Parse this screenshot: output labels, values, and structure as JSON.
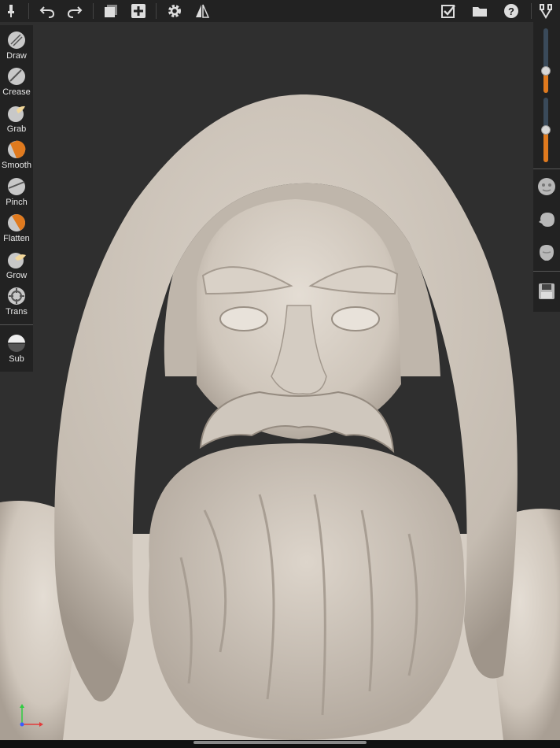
{
  "toolbar": {
    "left_icons": [
      "paint-icon",
      "undo-icon",
      "redo-icon",
      "layers-icon",
      "add-icon",
      "settings-icon",
      "symmetry-icon"
    ],
    "right_icons": [
      "checkbox-icon",
      "folder-icon",
      "help-icon",
      "tools-icon"
    ]
  },
  "tools": [
    {
      "label": "Draw",
      "icon": "draw-icon"
    },
    {
      "label": "Crease",
      "icon": "crease-icon"
    },
    {
      "label": "Grab",
      "icon": "grab-icon"
    },
    {
      "label": "Smooth",
      "icon": "smooth-icon"
    },
    {
      "label": "Pinch",
      "icon": "pinch-icon"
    },
    {
      "label": "Flatten",
      "icon": "flatten-icon"
    },
    {
      "label": "Grow",
      "icon": "grow-icon"
    },
    {
      "label": "Trans",
      "icon": "transform-icon"
    }
  ],
  "sub_tool": {
    "label": "Sub",
    "icon": "subtract-icon"
  },
  "right_panel": {
    "radius_slider_level": 0.35,
    "intensity_slider_level": 0.5,
    "buttons": [
      "matcap-face-icon",
      "matcap-side-icon",
      "matcap-head-icon",
      "save-icon"
    ]
  },
  "colors": {
    "accent": "#e07a1e",
    "panel": "#222222",
    "viewport": "#2f2f2f",
    "clay": "#d8d0c6"
  }
}
